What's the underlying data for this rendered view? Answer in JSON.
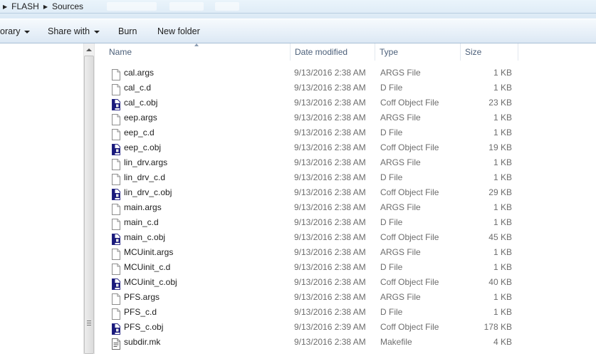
{
  "breadcrumb": {
    "items": [
      "FLASH",
      "Sources"
    ]
  },
  "toolbar": {
    "library_label": "orary",
    "share_label": "Share with",
    "burn_label": "Burn",
    "new_folder_label": "New folder"
  },
  "columns": {
    "name": "Name",
    "date": "Date modified",
    "type": "Type",
    "size": "Size"
  },
  "files": [
    {
      "name": "cal.args",
      "date": "9/13/2016 2:38 AM",
      "type": "ARGS File",
      "size": "1 KB",
      "icon": "document-icon"
    },
    {
      "name": "cal_c.d",
      "date": "9/13/2016 2:38 AM",
      "type": "D File",
      "size": "1 KB",
      "icon": "document-icon"
    },
    {
      "name": "cal_c.obj",
      "date": "9/13/2016 2:38 AM",
      "type": "Coff Object File",
      "size": "23 KB",
      "icon": "object-file-icon"
    },
    {
      "name": "eep.args",
      "date": "9/13/2016 2:38 AM",
      "type": "ARGS File",
      "size": "1 KB",
      "icon": "document-icon"
    },
    {
      "name": "eep_c.d",
      "date": "9/13/2016 2:38 AM",
      "type": "D File",
      "size": "1 KB",
      "icon": "document-icon"
    },
    {
      "name": "eep_c.obj",
      "date": "9/13/2016 2:38 AM",
      "type": "Coff Object File",
      "size": "19 KB",
      "icon": "object-file-icon"
    },
    {
      "name": "lin_drv.args",
      "date": "9/13/2016 2:38 AM",
      "type": "ARGS File",
      "size": "1 KB",
      "icon": "document-icon"
    },
    {
      "name": "lin_drv_c.d",
      "date": "9/13/2016 2:38 AM",
      "type": "D File",
      "size": "1 KB",
      "icon": "document-icon"
    },
    {
      "name": "lin_drv_c.obj",
      "date": "9/13/2016 2:38 AM",
      "type": "Coff Object File",
      "size": "29 KB",
      "icon": "object-file-icon"
    },
    {
      "name": "main.args",
      "date": "9/13/2016 2:38 AM",
      "type": "ARGS File",
      "size": "1 KB",
      "icon": "document-icon"
    },
    {
      "name": "main_c.d",
      "date": "9/13/2016 2:38 AM",
      "type": "D File",
      "size": "1 KB",
      "icon": "document-icon"
    },
    {
      "name": "main_c.obj",
      "date": "9/13/2016 2:38 AM",
      "type": "Coff Object File",
      "size": "45 KB",
      "icon": "object-file-icon"
    },
    {
      "name": "MCUinit.args",
      "date": "9/13/2016 2:38 AM",
      "type": "ARGS File",
      "size": "1 KB",
      "icon": "document-icon"
    },
    {
      "name": "MCUinit_c.d",
      "date": "9/13/2016 2:38 AM",
      "type": "D File",
      "size": "1 KB",
      "icon": "document-icon"
    },
    {
      "name": "MCUinit_c.obj",
      "date": "9/13/2016 2:38 AM",
      "type": "Coff Object File",
      "size": "40 KB",
      "icon": "object-file-icon"
    },
    {
      "name": "PFS.args",
      "date": "9/13/2016 2:38 AM",
      "type": "ARGS File",
      "size": "1 KB",
      "icon": "document-icon"
    },
    {
      "name": "PFS_c.d",
      "date": "9/13/2016 2:38 AM",
      "type": "D File",
      "size": "1 KB",
      "icon": "document-icon"
    },
    {
      "name": "PFS_c.obj",
      "date": "9/13/2016 2:39 AM",
      "type": "Coff Object File",
      "size": "178 KB",
      "icon": "object-file-icon"
    },
    {
      "name": "subdir.mk",
      "date": "9/13/2016 2:38 AM",
      "type": "Makefile",
      "size": "4 KB",
      "icon": "makefile-icon"
    }
  ]
}
